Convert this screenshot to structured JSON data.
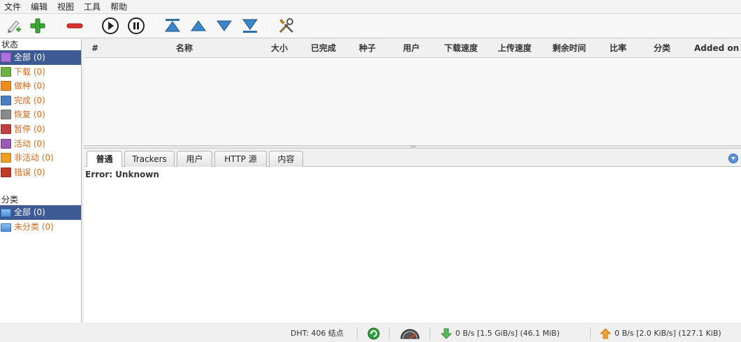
{
  "menu": [
    "文件",
    "编辑",
    "视图",
    "工具",
    "帮助"
  ],
  "toolbar": {
    "icons": [
      "add-link-icon",
      "add-torrent-icon",
      "remove-icon",
      "resume-icon",
      "pause-icon",
      "move-top-icon",
      "move-up-icon",
      "move-down-icon",
      "move-bottom-icon",
      "settings-icon"
    ]
  },
  "sidebar": {
    "status_header": "状态",
    "status_items": [
      {
        "label": "全部 (0)",
        "selected": true,
        "color": "#b070e0"
      },
      {
        "label": "下载 (0)",
        "selected": false,
        "color": "#6cb33f"
      },
      {
        "label": "做种 (0)",
        "selected": false,
        "color": "#f08a1c"
      },
      {
        "label": "完成 (0)",
        "selected": false,
        "color": "#4a7fc1"
      },
      {
        "label": "恢复 (0)",
        "selected": false,
        "color": "#8a8a8a"
      },
      {
        "label": "暂停 (0)",
        "selected": false,
        "color": "#c04040"
      },
      {
        "label": "活动 (0)",
        "selected": false,
        "color": "#9b59b6"
      },
      {
        "label": "非活动 (0)",
        "selected": false,
        "color": "#f0a020"
      },
      {
        "label": "错误 (0)",
        "selected": false,
        "color": "#c0392b"
      }
    ],
    "category_header": "分类",
    "category_items": [
      {
        "label": "全部 (0)",
        "selected": true
      },
      {
        "label": "未分类 (0)",
        "selected": false
      }
    ]
  },
  "columns": [
    "#",
    "名称",
    "大小",
    "已完成",
    "种子",
    "用户",
    "下载速度",
    "上传速度",
    "剩余时间",
    "比率",
    "分类",
    "Added on"
  ],
  "tabs": [
    {
      "label": "普通",
      "active": true
    },
    {
      "label": "Trackers",
      "active": false
    },
    {
      "label": "用户",
      "active": false
    },
    {
      "label": "HTTP 源",
      "active": false
    },
    {
      "label": "内容",
      "active": false
    }
  ],
  "detail": {
    "error_text": "Error: Unknown"
  },
  "statusbar": {
    "dht": "DHT:  406 结点",
    "download": "0 B/s [1.5 GiB/s] (46.1 MiB)",
    "upload": "0 B/s [2.0 KiB/s] (127.1 KiB)"
  },
  "colors": {
    "selection": "#3d5a94",
    "link_orange": "#d2691e"
  }
}
